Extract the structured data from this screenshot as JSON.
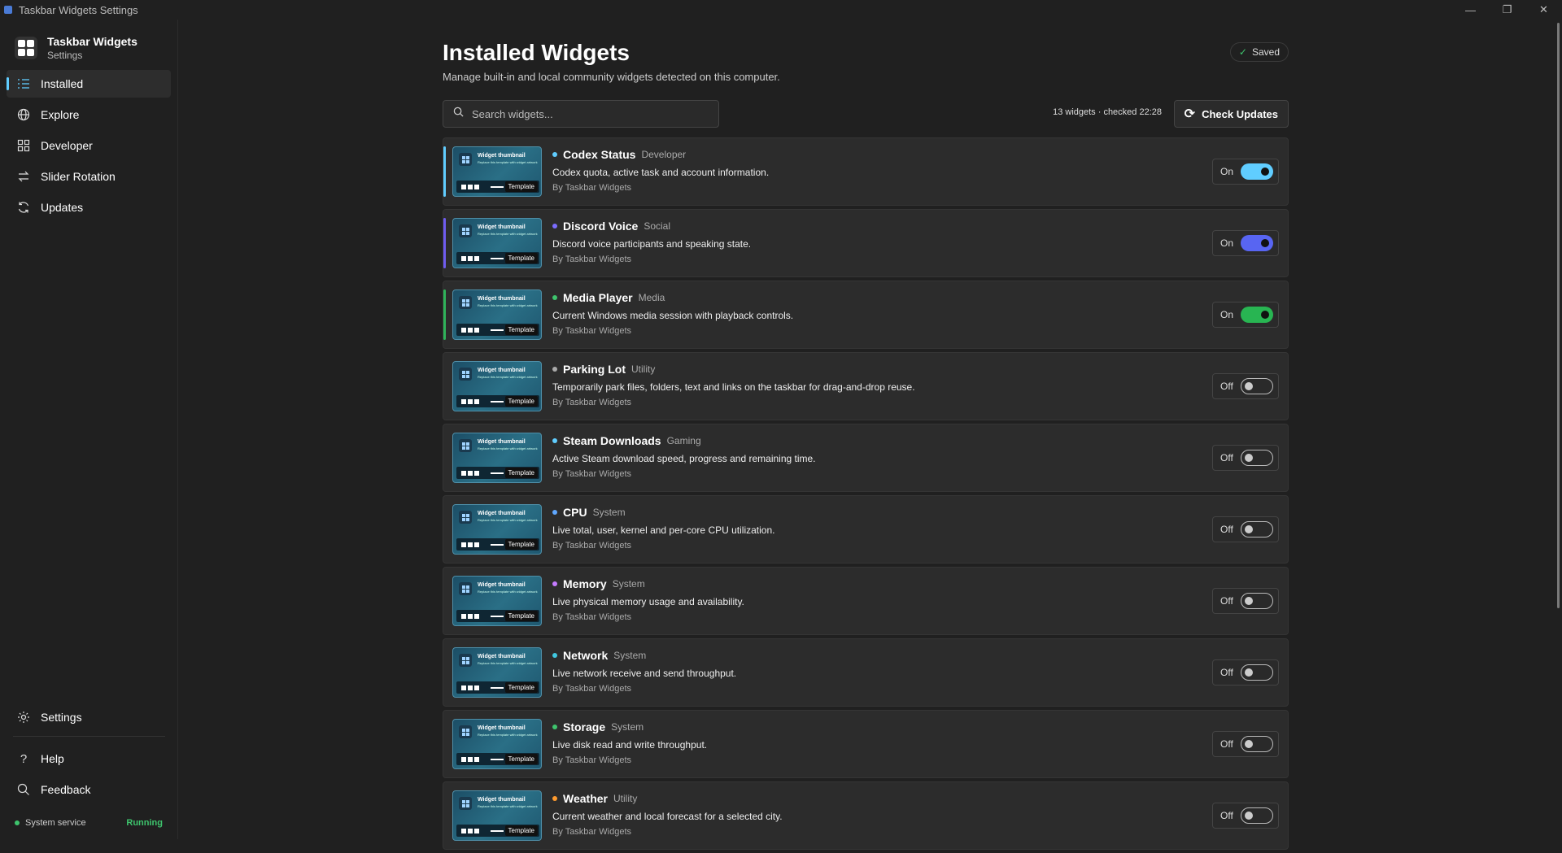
{
  "window": {
    "title": "Taskbar Widgets Settings",
    "controls": [
      "—",
      "❐",
      "✕"
    ]
  },
  "brand": {
    "title": "Taskbar Widgets",
    "subtitle": "Settings"
  },
  "nav": [
    {
      "label": "Installed",
      "icon": "list-icon",
      "active": true
    },
    {
      "label": "Explore",
      "icon": "globe-icon"
    },
    {
      "label": "Developer",
      "icon": "grid-icon"
    },
    {
      "label": "Slider Rotation",
      "icon": "swap-icon"
    },
    {
      "label": "Updates",
      "icon": "refresh-icon"
    }
  ],
  "bottom_nav": [
    {
      "label": "Settings",
      "icon": "gear-icon"
    },
    {
      "label": "Help",
      "icon": "question-icon"
    },
    {
      "label": "Feedback",
      "icon": "feedback-icon"
    }
  ],
  "service": {
    "label": "System service",
    "status": "Running"
  },
  "header": {
    "title": "Installed Widgets",
    "subtitle": "Manage built-in and local community widgets detected on this computer.",
    "saved": "Saved"
  },
  "search": {
    "placeholder": "Search widgets..."
  },
  "summary": "13 widgets · checked 22:28",
  "check_updates": "Check Updates",
  "thumbnail": {
    "title": "Widget thumbnail",
    "sub": "Replace this template with widget artwork",
    "tag": "Template"
  },
  "widgets": [
    {
      "name": "Codex Status",
      "category": "Developer",
      "desc": "Codex quota, active task and account information.",
      "author": "By Taskbar Widgets",
      "state": "On",
      "enabled": true,
      "dot": "#60cdff",
      "accent": "#60cdff",
      "switch": "#60cdff"
    },
    {
      "name": "Discord Voice",
      "category": "Social",
      "desc": "Discord voice participants and speaking state.",
      "author": "By Taskbar Widgets",
      "state": "On",
      "enabled": true,
      "dot": "#7b6cff",
      "accent": "#6f5cf0",
      "switch": "#5865f2"
    },
    {
      "name": "Media Player",
      "category": "Media",
      "desc": "Current Windows media session with playback controls.",
      "author": "By Taskbar Widgets",
      "state": "On",
      "enabled": true,
      "dot": "#3ec46d",
      "accent": "#2fb35a",
      "switch": "#28b552"
    },
    {
      "name": "Parking Lot",
      "category": "Utility",
      "desc": "Temporarily park files, folders, text and links on the taskbar for drag-and-drop reuse.",
      "author": "By Taskbar Widgets",
      "state": "Off",
      "enabled": false,
      "dot": "#aaaaaa"
    },
    {
      "name": "Steam Downloads",
      "category": "Gaming",
      "desc": "Active Steam download speed, progress and remaining time.",
      "author": "By Taskbar Widgets",
      "state": "Off",
      "enabled": false,
      "dot": "#60cdff"
    },
    {
      "name": "CPU",
      "category": "System",
      "desc": "Live total, user, kernel and per-core CPU utilization.",
      "author": "By Taskbar Widgets",
      "state": "Off",
      "enabled": false,
      "dot": "#60a8ff"
    },
    {
      "name": "Memory",
      "category": "System",
      "desc": "Live physical memory usage and availability.",
      "author": "By Taskbar Widgets",
      "state": "Off",
      "enabled": false,
      "dot": "#c57bff"
    },
    {
      "name": "Network",
      "category": "System",
      "desc": "Live network receive and send throughput.",
      "author": "By Taskbar Widgets",
      "state": "Off",
      "enabled": false,
      "dot": "#40c8e0"
    },
    {
      "name": "Storage",
      "category": "System",
      "desc": "Live disk read and write throughput.",
      "author": "By Taskbar Widgets",
      "state": "Off",
      "enabled": false,
      "dot": "#3ec46d"
    },
    {
      "name": "Weather",
      "category": "Utility",
      "desc": "Current weather and local forecast for a selected city.",
      "author": "By Taskbar Widgets",
      "state": "Off",
      "enabled": false,
      "dot": "#ff9b2e"
    }
  ]
}
